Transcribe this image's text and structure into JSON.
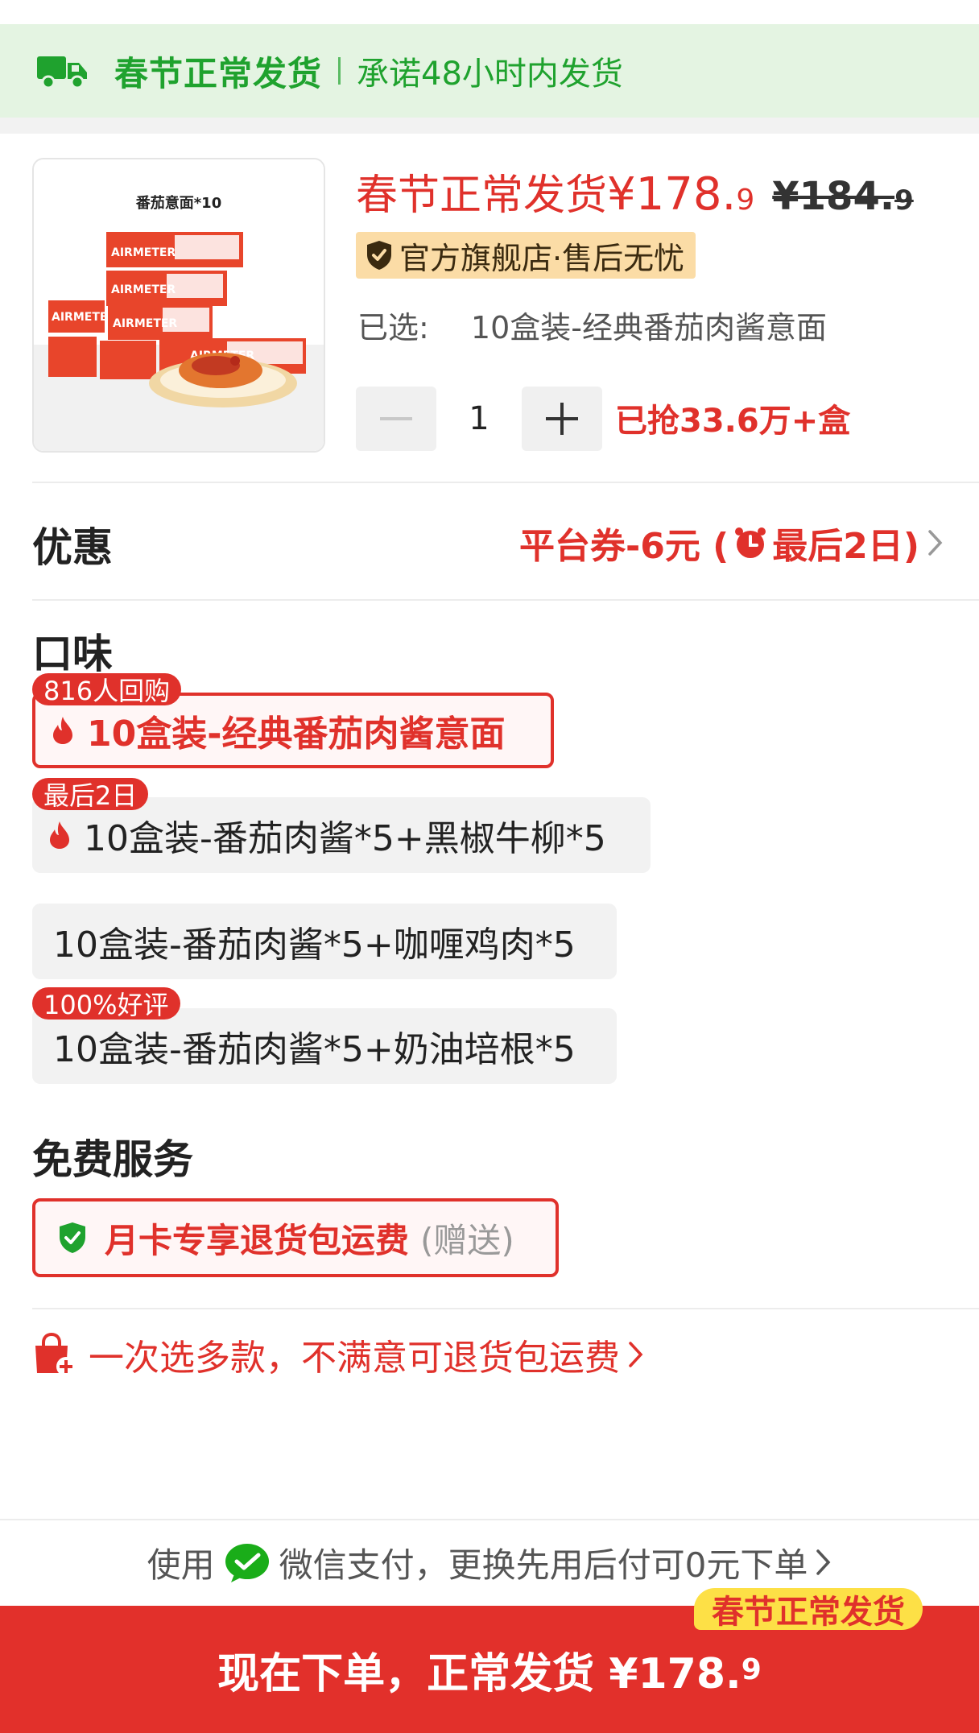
{
  "banner": {
    "title": "春节正常发货",
    "subtitle": "承诺48小时内发货",
    "icon": "truck-icon"
  },
  "product": {
    "image_caption": "番茄意面*10",
    "image_brand": "AIRMETER",
    "price_prefix": "春节正常发货",
    "price_main": "¥178.",
    "price_decimal": "9",
    "original_price_main": "¥184.",
    "original_price_decimal": "9",
    "store_badge": "官方旗舰店·售后无忧",
    "selected_label": "已选:",
    "selected_value": "10盒装-经典番茄肉酱意面",
    "quantity": "1",
    "sold_text": "已抢33.6万+盒"
  },
  "promo": {
    "label": "优惠",
    "value_main": "平台券-6元 (",
    "value_deadline": "最后2日)"
  },
  "flavor": {
    "title": "口味",
    "options": [
      {
        "label": "10盒装-经典番茄肉酱意面",
        "tag": "816人回购",
        "selected": true,
        "hot": true
      },
      {
        "label": "10盒装-番茄肉酱*5+黑椒牛柳*5",
        "tag": "最后2日",
        "selected": false,
        "hot": true
      },
      {
        "label": "10盒装-番茄肉酱*5+咖喱鸡肉*5",
        "tag": "",
        "selected": false,
        "hot": false
      },
      {
        "label": "10盒装-番茄肉酱*5+奶油培根*5",
        "tag": "100%好评",
        "selected": false,
        "hot": false
      }
    ]
  },
  "service": {
    "title": "免费服务",
    "option_label": "月卡专享退货包运费",
    "option_note": "(赠送)"
  },
  "returns_text": "一次选多款，不满意可退货包运费",
  "payment": {
    "prefix": "使用",
    "text": "微信支付，更换先用后付可0元下单"
  },
  "buy": {
    "label": "现在下单，正常发货 ¥178.",
    "decimal": "9",
    "tag": "春节正常发货"
  },
  "colors": {
    "accent": "#e0312b",
    "green": "#1fa22e",
    "banner_bg": "#e4f4e2",
    "badge_bg": "#fbdca6",
    "tag_yellow": "#fde046"
  }
}
